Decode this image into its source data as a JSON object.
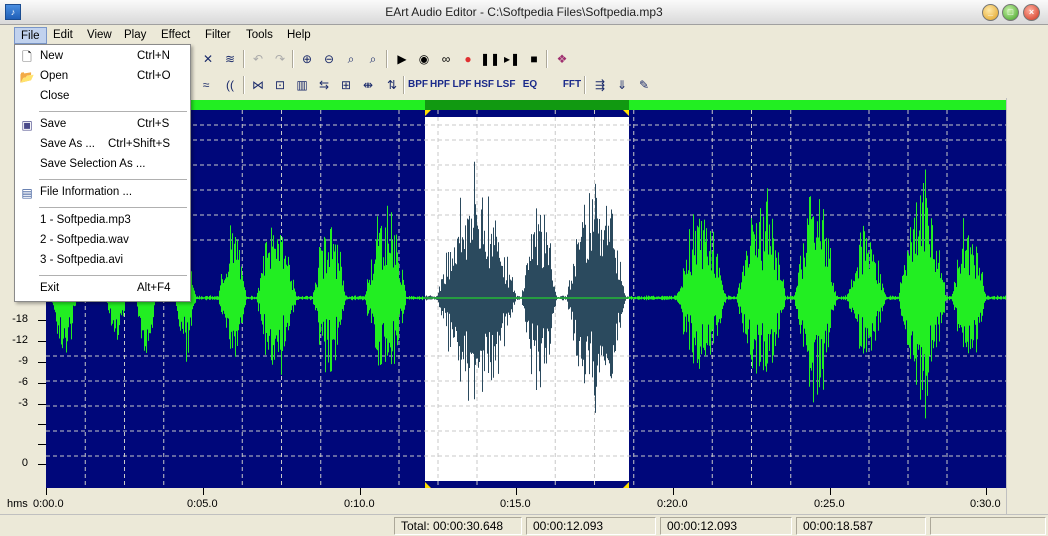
{
  "window": {
    "title": "EArt Audio Editor - C:\\Softpedia Files\\Softpedia.mp3"
  },
  "menubar": [
    "File",
    "Edit",
    "View",
    "Play",
    "Effect",
    "Filter",
    "Tools",
    "Help"
  ],
  "file_menu": {
    "items": [
      {
        "label": "New",
        "shortcut": "Ctrl+N",
        "icon": "new-file-icon"
      },
      {
        "label": "Open",
        "shortcut": "Ctrl+O",
        "icon": "folder-icon"
      },
      {
        "label": "Close",
        "shortcut": ""
      },
      {
        "label": "Save",
        "shortcut": "Ctrl+S",
        "icon": "floppy-icon"
      },
      {
        "label": "Save As ...",
        "shortcut": "Ctrl+Shift+S"
      },
      {
        "label": "Save Selection As ...",
        "shortcut": ""
      },
      {
        "label": "File Information ...",
        "shortcut": "",
        "icon": "info-icon"
      },
      {
        "label": "1 - Softpedia.mp3",
        "shortcut": ""
      },
      {
        "label": "2 - Softpedia.wav",
        "shortcut": ""
      },
      {
        "label": "3 - Softpedia.avi",
        "shortcut": ""
      },
      {
        "label": "Exit",
        "shortcut": "Alt+F4"
      }
    ]
  },
  "toolbar2_text_buttons": [
    "BPF",
    "HPF",
    "LPF",
    "HSF",
    "LSF",
    "EQ",
    "FFT"
  ],
  "db_scale": [
    "-18",
    "-12",
    "-9",
    "-6",
    "-3",
    "0"
  ],
  "timeline": {
    "unit_label": "hms",
    "labels": [
      "0:00.0",
      "0:05.0",
      "0:10.0",
      "0:15.0",
      "0:20.0",
      "0:25.0",
      "0:30.0"
    ]
  },
  "status": {
    "total": "Total: 00:00:30.648",
    "selection_start": "00:00:12.093",
    "cursor": "00:00:12.093",
    "selection_end": "00:00:18.587"
  },
  "colors": {
    "wave_background": "#00077a",
    "wave_green": "#22ee22",
    "selection_background": "#ffffff",
    "selection_wave": "#2b4a5e",
    "overview_green": "#22ee22"
  }
}
